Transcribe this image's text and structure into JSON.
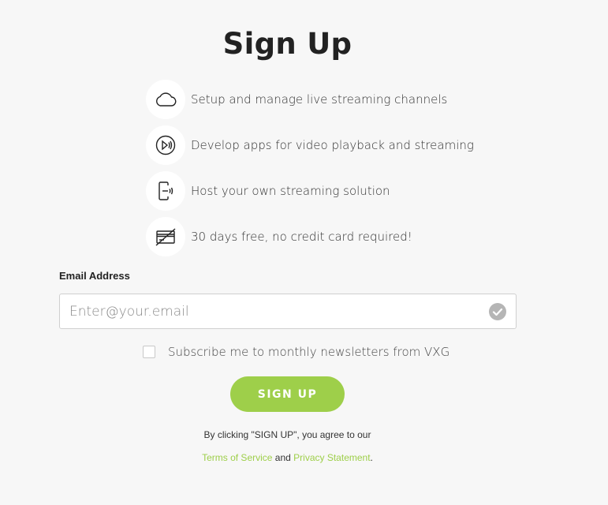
{
  "page": {
    "title": "Sign Up"
  },
  "features": [
    {
      "icon": "cloud-icon",
      "text": "Setup and manage live streaming channels"
    },
    {
      "icon": "play-broadcast-icon",
      "text": "Develop apps for video playback and streaming"
    },
    {
      "icon": "device-stream-icon",
      "text": "Host your own streaming solution"
    },
    {
      "icon": "no-credit-card-icon",
      "text": "30 days free, no credit card required!"
    }
  ],
  "form": {
    "email_label": "Email Address",
    "email_placeholder": "Enter@your.email",
    "email_value": "",
    "subscribe_label": "Subscribe me to monthly newsletters from VXG",
    "subscribe_checked": false,
    "submit_label": "SIGN UP"
  },
  "legal": {
    "agree_text": "By clicking \"SIGN UP\", you agree to our",
    "terms_label": "Terms of Service",
    "and_text": "and",
    "privacy_label": "Privacy Statement",
    "end_punct": "."
  },
  "colors": {
    "accent": "#9ecf4a",
    "background": "#f7f7f7",
    "valid_check": "#b5b5b5"
  }
}
